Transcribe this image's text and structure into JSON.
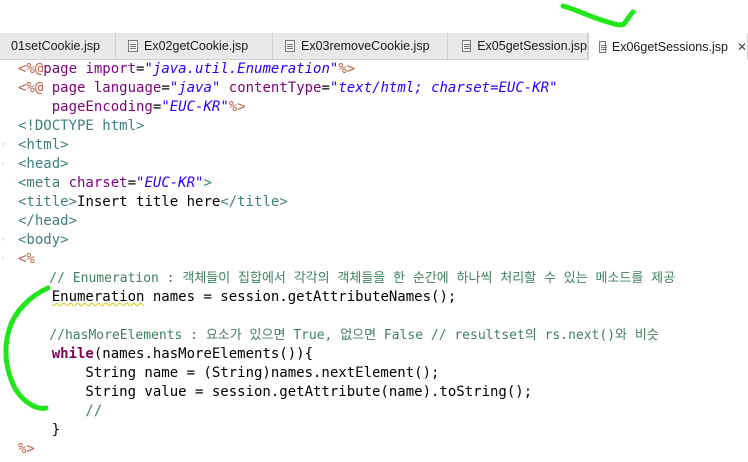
{
  "tabs": [
    {
      "label": "01setCookie.jsp",
      "active": false
    },
    {
      "label": "Ex02getCookie.jsp",
      "active": false
    },
    {
      "label": "Ex03removeCookie.jsp",
      "active": false
    },
    {
      "label": "Ex05getSession.jsp",
      "active": false
    },
    {
      "label": "Ex06getSessions.jsp",
      "active": true
    }
  ],
  "close_glyph": "✕",
  "colors": {
    "jsp_delimiter": "#bf5f3f",
    "html_tag": "#3f7f7f",
    "attribute": "#7f007f",
    "string": "#2a00ff",
    "comment": "#3f7f5f",
    "keyword": "#7f0055",
    "annotation": "#22e61c"
  },
  "code": {
    "l1": {
      "a": "<%@",
      "b": "page ",
      "c": "import",
      "d": "=",
      "e": "\"java.util.Enumeration\"",
      "f": "%>"
    },
    "l2": {
      "a": "<%@",
      "b": " page ",
      "c": "language",
      "d": "=",
      "e": "\"java\"",
      "f": " ",
      "g": "contentType",
      "h": "=",
      "i": "\"text/html; charset=EUC-KR\""
    },
    "l3": {
      "a": "    ",
      "b": "pageEncoding",
      "c": "=",
      "d": "\"EUC-KR\"",
      "e": "%>"
    },
    "l4": {
      "a": "<!DOCTYPE html>"
    },
    "l5": {
      "a": "<html>"
    },
    "l6": {
      "a": "<head>"
    },
    "l7": {
      "a": "<meta ",
      "b": "charset",
      "c": "=",
      "d": "\"EUC-KR\"",
      "e": ">"
    },
    "l8": {
      "a": "<title>",
      "b": "Insert title here",
      "c": "</title>"
    },
    "l9": {
      "a": "</head>"
    },
    "l10": {
      "a": "<body>"
    },
    "l11": {
      "a": "<%"
    },
    "l12": {
      "a": "    // Enumeration : 객체들이 집합에서 각각의 객체들을 한 순간에 하나씩 처리할 수 있는 메소드를 제공"
    },
    "l13": {
      "a": "    ",
      "b": "Enumeration",
      "c": " names = session.getAttributeNames();"
    },
    "l14": {
      "a": ""
    },
    "l15": {
      "a": "    //hasMoreElements : 요소가 있으면 True, 없으면 False // resultset의 rs.next()와 비슷"
    },
    "l16": {
      "a": "    ",
      "b": "while",
      "c": "(names.hasMoreElements()){"
    },
    "l17": {
      "a": "        String name = (String)names.nextElement();"
    },
    "l18": {
      "a": "        String value = session.getAttribute(name).toString();"
    },
    "l19": {
      "a": "        //"
    },
    "l20": {
      "a": "    }"
    },
    "l21": {
      "a": "%>"
    }
  }
}
